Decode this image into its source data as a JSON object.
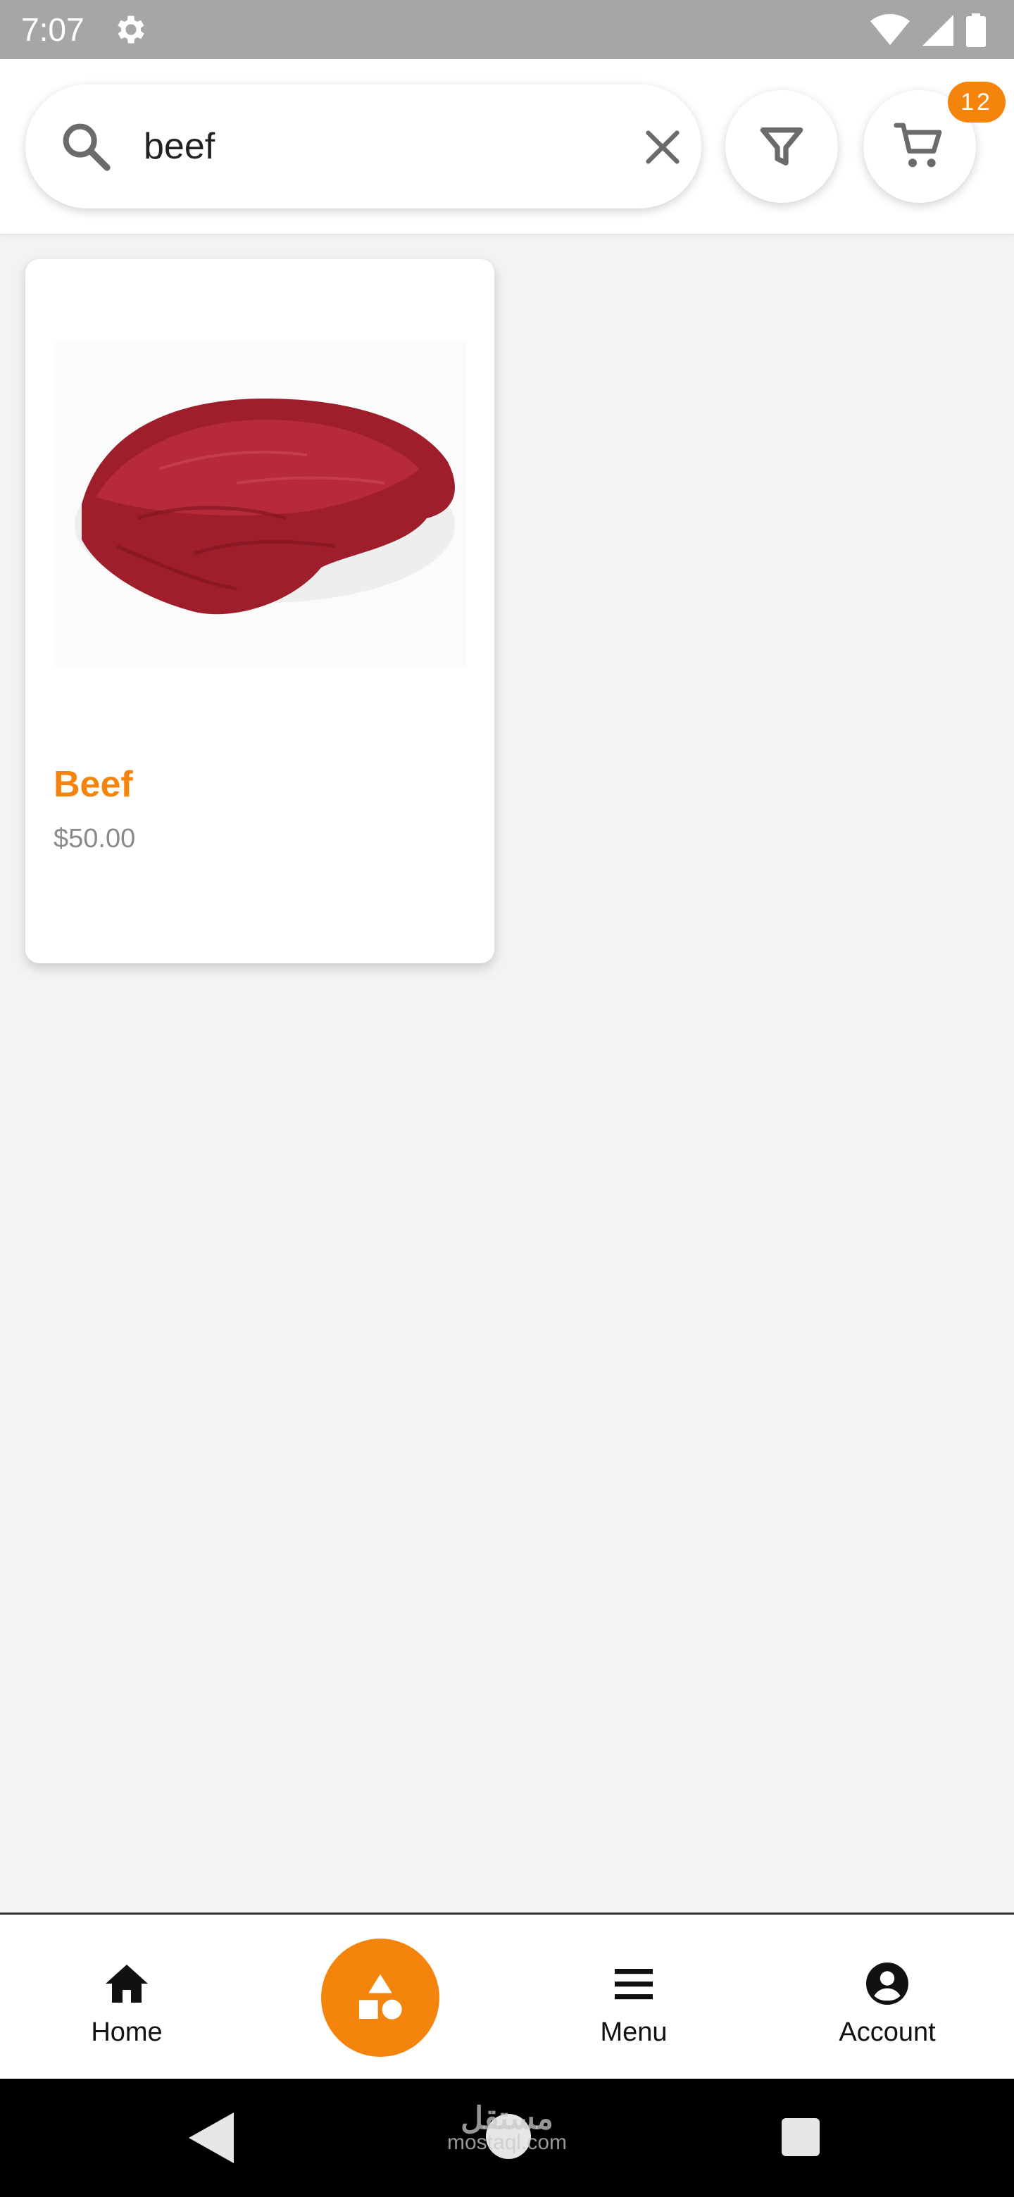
{
  "status_bar": {
    "time": "7:07"
  },
  "search": {
    "value": "beef",
    "placeholder": ""
  },
  "cart": {
    "badge_count": "12"
  },
  "products": [
    {
      "name": "Beef",
      "price": "$50.00"
    }
  ],
  "bottom_nav": {
    "home_label": "Home",
    "menu_label": "Menu",
    "account_label": "Account"
  },
  "watermark": {
    "arabic": "مستقل",
    "latin": "mostaql.com"
  },
  "colors": {
    "accent": "#f5840c",
    "background": "#f3f3f3"
  },
  "icons": {
    "status": [
      "gear-icon",
      "wifi-icon",
      "signal-icon",
      "battery-icon"
    ],
    "header": [
      "search-icon",
      "clear-icon",
      "filter-icon",
      "cart-icon"
    ],
    "nav": [
      "home-icon",
      "shapes-icon",
      "menu-icon",
      "account-icon"
    ]
  }
}
